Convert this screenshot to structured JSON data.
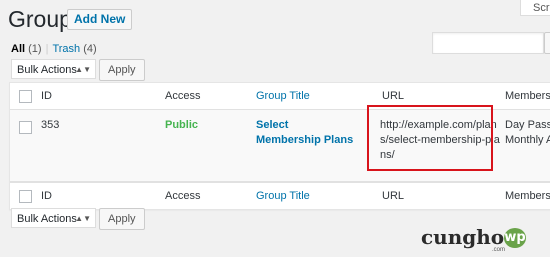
{
  "header": {
    "title": "Groups",
    "add_new_label": "Add New",
    "screen_options_label": "Scre"
  },
  "filters": {
    "all_label": "All",
    "all_count": "(1)",
    "separator": "|",
    "trash_label": "Trash",
    "trash_count": "(4)"
  },
  "bulk_top": {
    "selected": "Bulk Actions",
    "apply_label": "Apply"
  },
  "bulk_bottom": {
    "selected": "Bulk Actions",
    "apply_label": "Apply"
  },
  "table": {
    "columns": [
      "ID",
      "Access",
      "Group Title",
      "URL",
      "Members"
    ],
    "columns_visible": [
      "ID",
      "Access",
      "Group Title",
      "URL",
      "Membersh"
    ],
    "rows": [
      {
        "id": "353",
        "access": "Public",
        "group_title": "Select Membership Plans",
        "url": "http://example.com/plans/select-membership-plans/",
        "members_line1": "Day Pass,",
        "members_line2": "Monthly Ac"
      }
    ]
  },
  "watermark": {
    "text": "cunghoc",
    "badge": "wp",
    "suffix": ".com"
  },
  "colors": {
    "link": "#0073aa",
    "public": "#46b450",
    "highlight_border": "#d8141c",
    "background": "#f1f1f1"
  }
}
